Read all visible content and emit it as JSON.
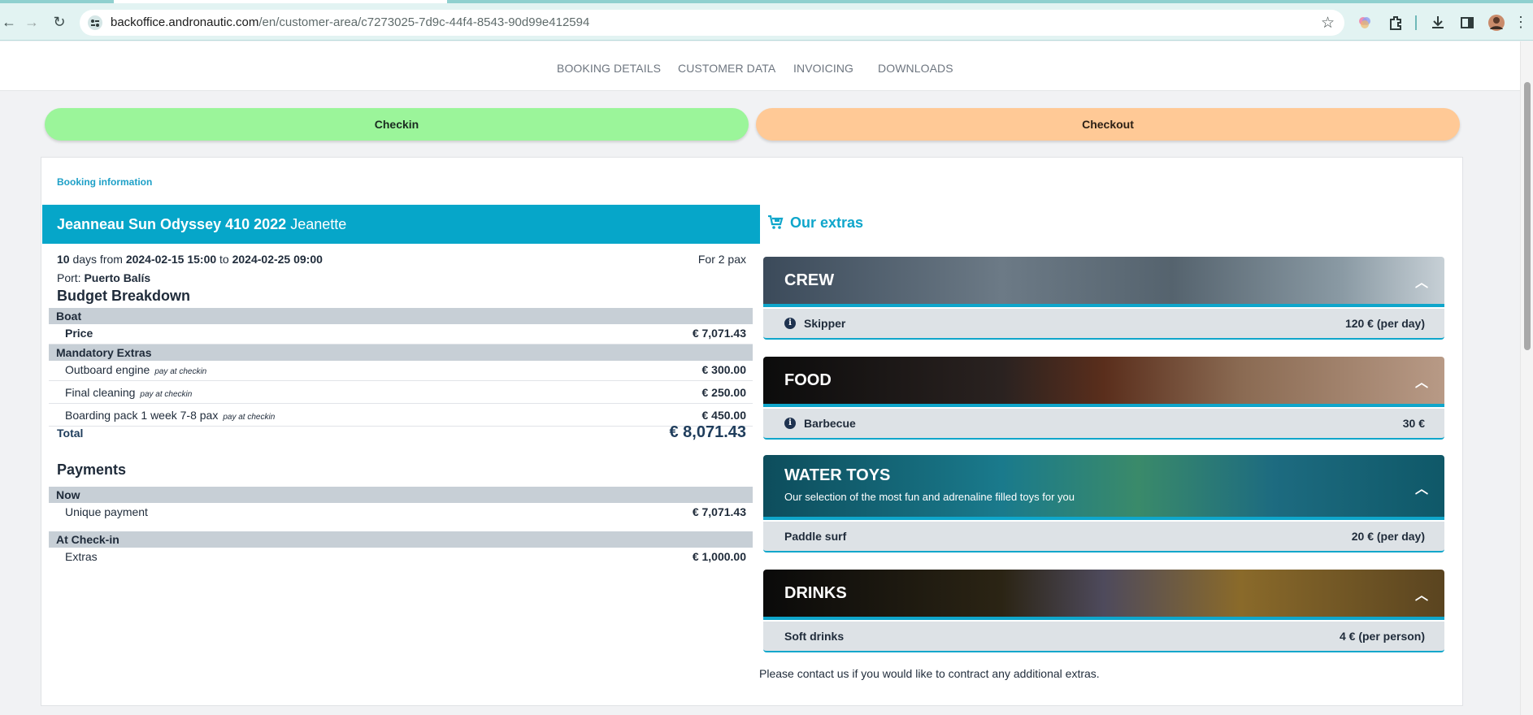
{
  "browser": {
    "url_host": "backoffice.andronautic.com",
    "url_path": "/en/customer-area/c7273025-7d9c-44f4-8543-90d99e412594"
  },
  "nav": {
    "items": [
      "BOOKING DETAILS",
      "CUSTOMER DATA",
      "INVOICING",
      "DOWNLOADS"
    ]
  },
  "actions": {
    "checkin": "Checkin",
    "checkout": "Checkout"
  },
  "booking": {
    "section_label": "Booking information",
    "boat_name": "Jeanneau Sun Odyssey 410 2022",
    "boat_nickname": "Jeanette",
    "days": "10",
    "days_word": "days from",
    "from": "2024-02-15 15:00",
    "to_word": "to",
    "to": "2024-02-25 09:00",
    "pax": "For 2 pax",
    "port_label": "Port:",
    "port": "Puerto Balís"
  },
  "budget": {
    "title": "Budget Breakdown",
    "boat_group": "Boat",
    "price_label": "Price",
    "price_amount": "€ 7,071.43",
    "mandatory_group": "Mandatory Extras",
    "items": [
      {
        "label": "Outboard engine",
        "note": "pay at checkin",
        "amount": "€ 300.00"
      },
      {
        "label": "Final cleaning",
        "note": "pay at checkin",
        "amount": "€ 250.00"
      },
      {
        "label": "Boarding pack 1 week 7-8 pax",
        "note": "pay at checkin",
        "amount": "€ 450.00"
      }
    ],
    "total_label": "Total",
    "total_amount": "€ 8,071.43"
  },
  "payments": {
    "title": "Payments",
    "now_group": "Now",
    "now_label": "Unique payment",
    "now_amount": "€ 7,071.43",
    "checkin_group": "At Check-in",
    "checkin_label": "Extras",
    "checkin_amount": "€ 1,000.00"
  },
  "extras": {
    "title": "Our extras",
    "categories": [
      {
        "name": "CREW",
        "description": "",
        "item": "Skipper",
        "price": "120 € (per day)"
      },
      {
        "name": "FOOD",
        "description": "",
        "item": "Barbecue",
        "price": "30 €"
      },
      {
        "name": "WATER TOYS",
        "description": "Our selection of the most fun and adrenaline filled toys for you",
        "item": "Paddle surf",
        "price": "20 € (per day)"
      },
      {
        "name": "DRINKS",
        "description": "",
        "item": "Soft drinks",
        "price": "4 € (per person)"
      }
    ],
    "contact_note": "Please contact us if you would like to contract any additional extras."
  },
  "colors": {
    "accent": "#06a6c9",
    "checkin": "#9bf59a",
    "checkout": "#ffc996"
  }
}
